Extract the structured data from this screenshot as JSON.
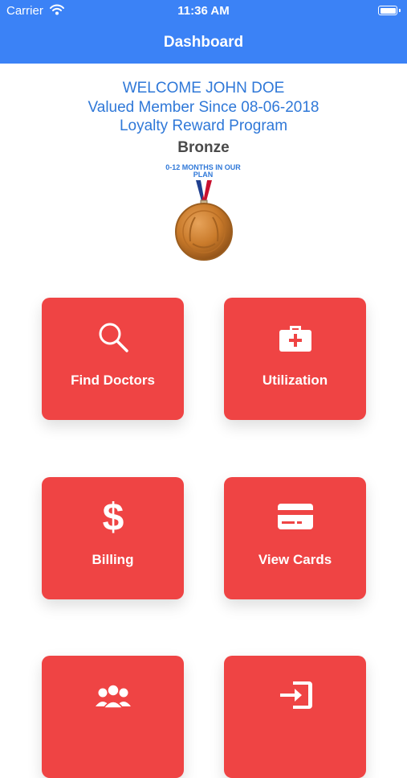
{
  "status_bar": {
    "carrier": "Carrier",
    "time": "11:36 AM"
  },
  "nav": {
    "title": "Dashboard"
  },
  "member": {
    "welcome": "WELCOME JOHN DOE",
    "since": "Valued Member Since 08-06-2018",
    "program": "Loyalty Reward Program",
    "tier": "Bronze",
    "plan_note": "0-12 MONTHS IN OUR PLAN"
  },
  "colors": {
    "header": "#3b82f6",
    "accent_text": "#2f78d8",
    "tile": "#ef4444"
  },
  "tiles": [
    {
      "label": "Find Doctors",
      "icon": "search-icon"
    },
    {
      "label": "Utilization",
      "icon": "medical-kit-icon"
    },
    {
      "label": "Billing",
      "icon": "dollar-icon"
    },
    {
      "label": "View Cards",
      "icon": "credit-card-icon"
    },
    {
      "label": "",
      "icon": "users-icon"
    },
    {
      "label": "",
      "icon": "sign-in-icon"
    }
  ]
}
